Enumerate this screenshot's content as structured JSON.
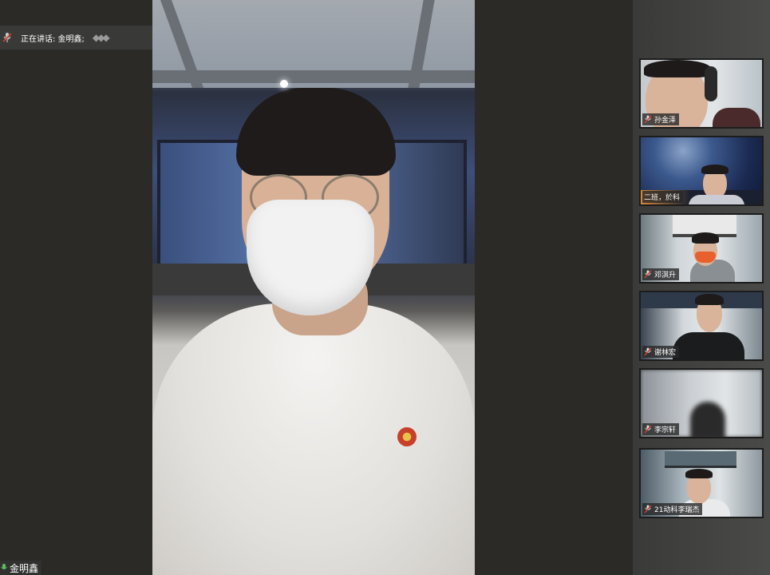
{
  "speaking": {
    "text": "正在讲话: 金明鑫;",
    "icon": "muted-mic-icon"
  },
  "main_video": {
    "name_tag": "金明鑫"
  },
  "participants": [
    {
      "name": "孙金泽",
      "mic": "muted-mic-icon"
    },
    {
      "name": "二班，於科",
      "mic": ""
    },
    {
      "name": "邓淇升",
      "mic": "muted-mic-icon"
    },
    {
      "name": "谢林宏",
      "mic": "muted-mic-icon"
    },
    {
      "name": "李宗轩",
      "mic": "muted-mic-icon"
    },
    {
      "name": "21动科李瑞杰",
      "mic": "muted-mic-icon"
    }
  ],
  "colors": {
    "background": "#2b2a27",
    "sidebar": "#444442",
    "label_bg": "#282828",
    "mic_muted": "#d04030"
  }
}
